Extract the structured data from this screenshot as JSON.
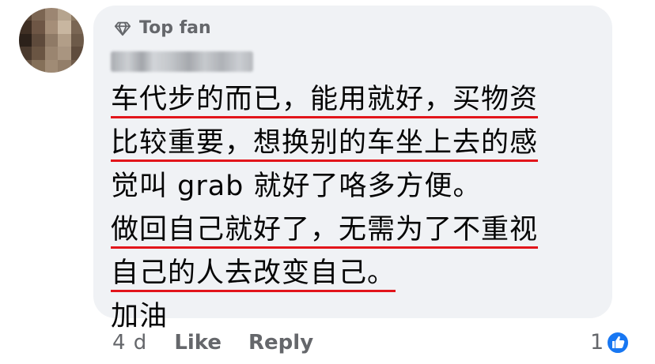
{
  "comment": {
    "badge_label": "Top fan",
    "lines": [
      "车代步的而已，能用就好，买物资",
      "比较重要，想换别的车坐上去的感",
      "觉叫 grab 就好了咯多方便。",
      "做回自己就好了，无需为了不重视",
      "自己的人去改变自己。",
      "加油"
    ]
  },
  "footer": {
    "timestamp": "4 d",
    "like_label": "Like",
    "reply_label": "Reply",
    "reaction_count": "1"
  },
  "colors": {
    "bubble": "#f0f2f5",
    "meta_text": "#65676b",
    "underline": "#e2151b",
    "like_blue": "#1877f2"
  },
  "icons": {
    "badge": "diamond-icon",
    "reaction": "like-thumb-icon"
  }
}
